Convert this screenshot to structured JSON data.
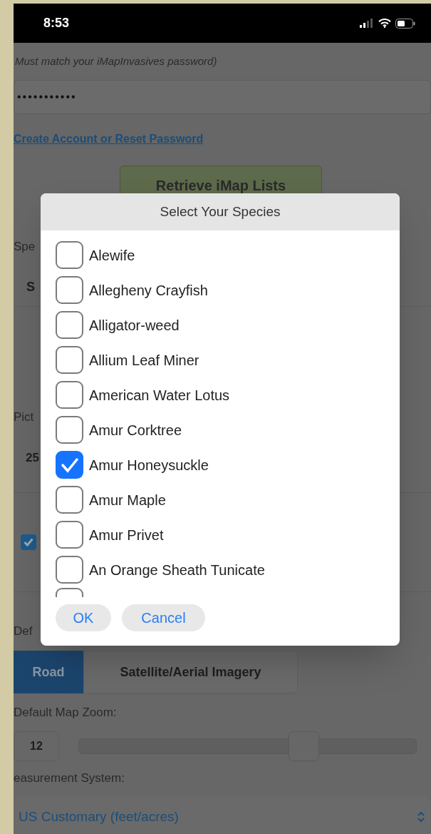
{
  "status_bar": {
    "time": "8:53"
  },
  "background": {
    "password_hint": "Must match your iMapInvasives password)",
    "password_field": {
      "value": "•••••••••••"
    },
    "account_link": "Create Account or Reset Password",
    "retrieve_button": "Retrieve iMap Lists",
    "species_label": "Spe",
    "species_value": "S",
    "picture_label": "Pict",
    "picture_value": "25",
    "option_checkbox": {
      "checked": true
    },
    "map_label": "Def",
    "map_type_tabs": [
      {
        "label": "Road",
        "selected": true
      },
      {
        "label": "Satellite/Aerial Imagery",
        "selected": false
      }
    ],
    "zoom_label": "Default Map Zoom:",
    "zoom_value": "12",
    "zoom_slider": {
      "level": 0.665
    },
    "measurement_label": "easurement System:",
    "measurement_select": {
      "value": "US Customary (feet/acres)"
    }
  },
  "dialog": {
    "title": "Select Your Species",
    "species": [
      {
        "label": "Alewife",
        "checked": false
      },
      {
        "label": "Allegheny Crayfish",
        "checked": false
      },
      {
        "label": "Alligator-weed",
        "checked": false
      },
      {
        "label": "Allium Leaf Miner",
        "checked": false
      },
      {
        "label": "American Water Lotus",
        "checked": false
      },
      {
        "label": "Amur Corktree",
        "checked": false
      },
      {
        "label": "Amur Honeysuckle",
        "checked": true
      },
      {
        "label": "Amur Maple",
        "checked": false
      },
      {
        "label": "Amur Privet",
        "checked": false
      },
      {
        "label": "An Orange Sheath Tunicate",
        "checked": false
      }
    ],
    "partial_row_checkbox": {
      "checked": false
    },
    "buttons": [
      "OK",
      "Cancel"
    ]
  }
}
